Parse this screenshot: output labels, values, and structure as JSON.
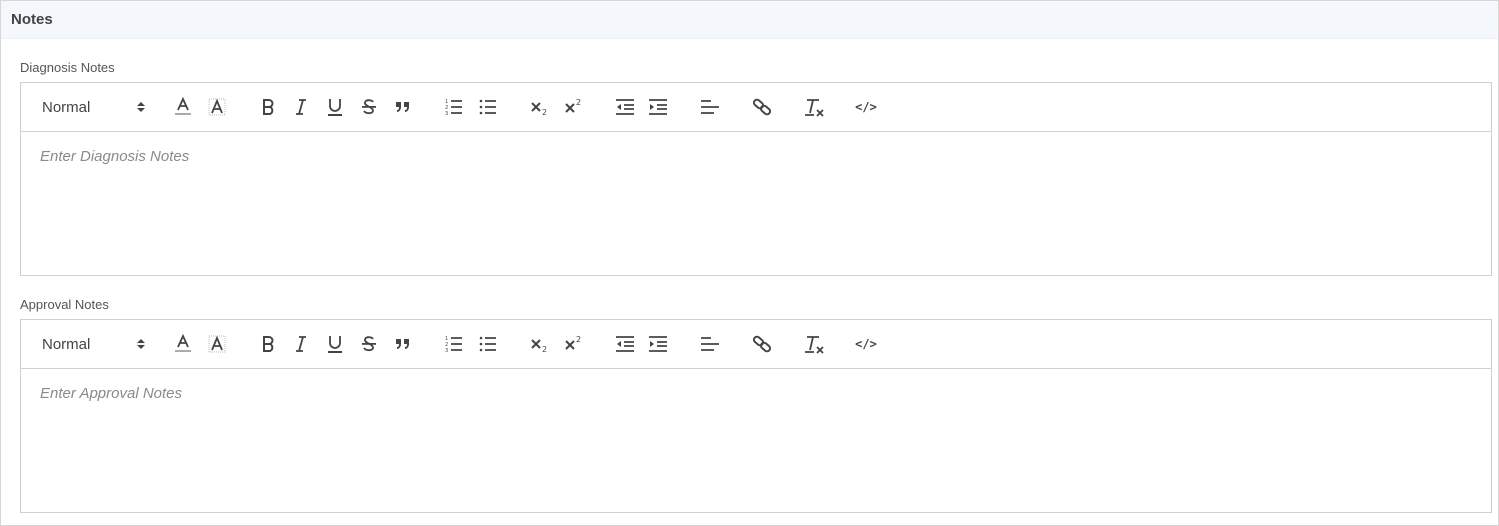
{
  "panel": {
    "title": "Notes"
  },
  "editors": [
    {
      "label": "Diagnosis Notes",
      "header_select": "Normal",
      "placeholder": "Enter Diagnosis Notes"
    },
    {
      "label": "Approval Notes",
      "header_select": "Normal",
      "placeholder": "Enter Approval Notes"
    }
  ],
  "toolbar_icons": [
    "text-color-icon",
    "background-color-icon",
    "bold-icon",
    "italic-icon",
    "underline-icon",
    "strikethrough-icon",
    "blockquote-icon",
    "ordered-list-icon",
    "bullet-list-icon",
    "subscript-icon",
    "superscript-icon",
    "outdent-icon",
    "indent-icon",
    "align-left-icon",
    "link-icon",
    "clear-format-icon",
    "code-block-icon"
  ],
  "code_symbol": "</>",
  "colors": {
    "header_bg": "#f4f7fb",
    "border": "#cfcfcf",
    "icon": "#444444"
  }
}
